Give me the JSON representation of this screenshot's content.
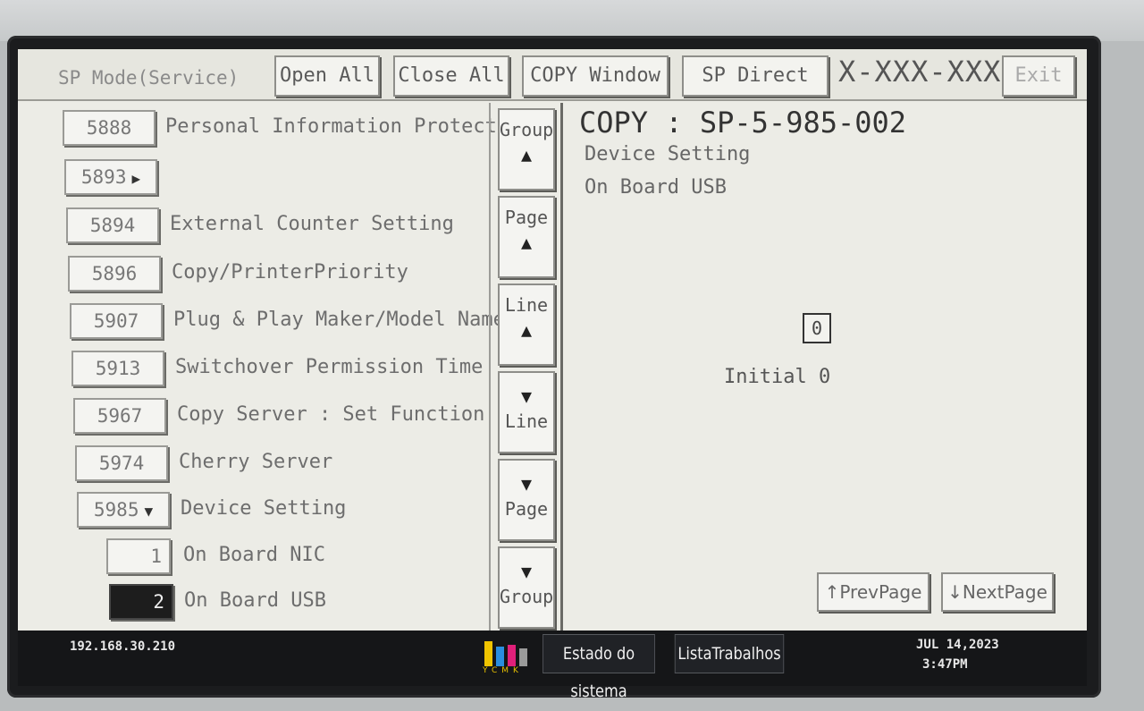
{
  "header": {
    "mode_label": "SP Mode(Service)",
    "open_all": "Open All",
    "close_all": "Close All",
    "copy_window": "COPY Window",
    "sp_direct": "SP Direct",
    "machine_id": "X-XXX-XXX",
    "exit": "Exit"
  },
  "items": [
    {
      "code": "5888",
      "label": "Personal Information Protect"
    },
    {
      "code": "5893",
      "label": ""
    },
    {
      "code": "5894",
      "label": "External Counter Setting"
    },
    {
      "code": "5896",
      "label": "Copy/PrinterPriority"
    },
    {
      "code": "5907",
      "label": "Plug & Play  Maker/Model Name"
    },
    {
      "code": "5913",
      "label": "Switchover Permission Time"
    },
    {
      "code": "5967",
      "label": "Copy Server : Set Function"
    },
    {
      "code": "5974",
      "label": "Cherry Server"
    },
    {
      "code": "5985",
      "label": "Device Setting"
    }
  ],
  "subitems": [
    {
      "code": "1",
      "label": "On Board NIC"
    },
    {
      "code": "2",
      "label": "On Board USB"
    }
  ],
  "nav": {
    "group_up": "Group",
    "page_up": "Page",
    "line_up": "Line",
    "line_down": "Line",
    "page_down": "Page",
    "group_down": "Group"
  },
  "detail": {
    "title": "COPY : SP-5-985-002",
    "line1": "Device Setting",
    "line2": "On Board USB",
    "value": "0",
    "initial": "Initial 0",
    "prev_page": "↑PrevPage",
    "next_page": "↓NextPage"
  },
  "status": {
    "ip": "192.168.30.210",
    "toner_letters": "YCMK",
    "system_status": "Estado do sistema",
    "job_list": "ListaTrabalhos",
    "date": "JUL  14,2023",
    "time": "3:47PM"
  }
}
